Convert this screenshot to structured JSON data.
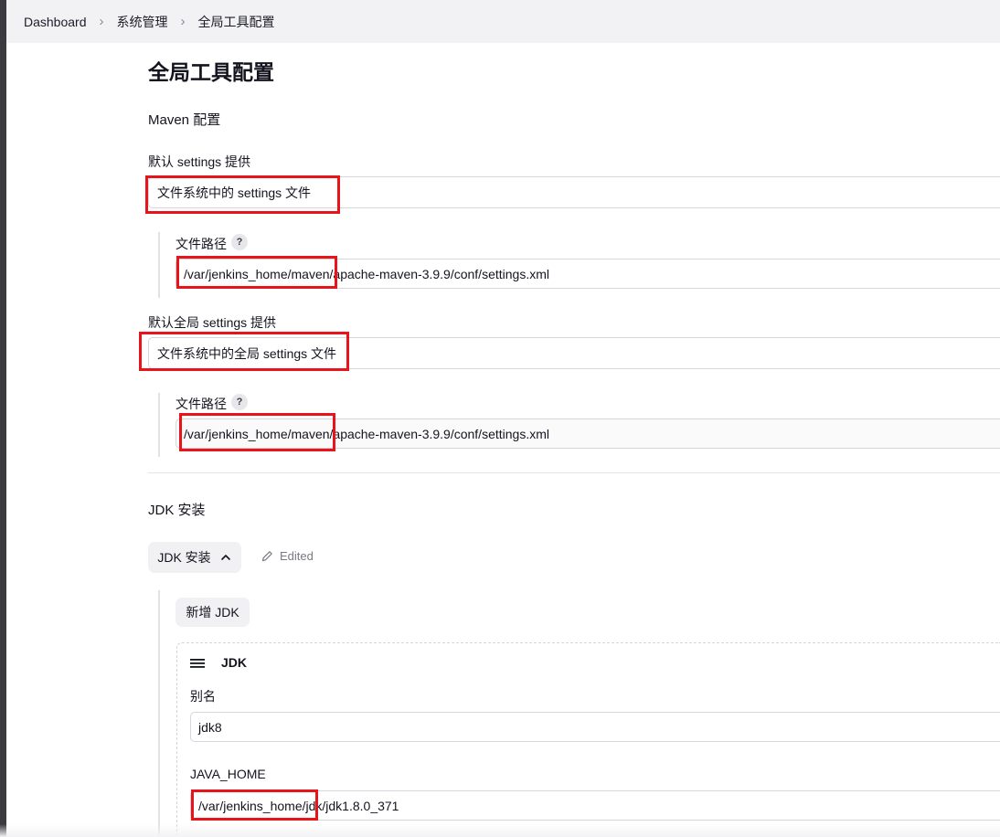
{
  "breadcrumb": {
    "items": [
      "Dashboard",
      "系统管理",
      "全局工具配置"
    ]
  },
  "page": {
    "title": "全局工具配置"
  },
  "maven": {
    "section_title": "Maven 配置",
    "default_settings": {
      "label": "默认 settings 提供",
      "value": "文件系统中的 settings 文件",
      "path_label": "文件路径",
      "path_value": "/var/jenkins_home/maven/apache-maven-3.9.9/conf/settings.xml"
    },
    "global_settings": {
      "label": "默认全局 settings 提供",
      "value": "文件系统中的全局 settings 文件",
      "path_label": "文件路径",
      "path_value": "/var/jenkins_home/maven/apache-maven-3.9.9/conf/settings.xml"
    },
    "help_glyph": "?"
  },
  "jdk": {
    "section_title": "JDK 安装",
    "toggle_label": "JDK 安装",
    "edited_label": "Edited",
    "add_button": "新增 JDK",
    "card": {
      "title": "JDK",
      "alias_label": "别名",
      "alias_value": "jdk8",
      "java_home_label": "JAVA_HOME",
      "java_home_value": "/var/jenkins_home/jdk/jdk1.8.0_371"
    }
  },
  "icons": {
    "chevron_right": "chevron-right-icon",
    "chevron_up": "chevron-up-icon",
    "pencil": "pencil-icon",
    "drag_handle": "drag-handle-icon",
    "help": "help-icon"
  },
  "colors": {
    "annotation_red": "#e8141a",
    "breadcrumb_bg": "#f2f2f4",
    "button_bg": "#f1f1f3"
  }
}
